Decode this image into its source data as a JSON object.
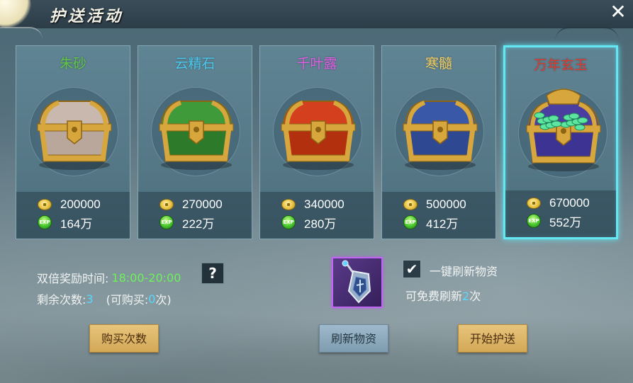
{
  "window": {
    "title": "护送活动"
  },
  "chests": [
    {
      "name": "朱砂",
      "name_color": "#62c64a",
      "gold": "200000",
      "exp": "164万",
      "lid": "#c9b8ad",
      "body": "#b9a79c",
      "selected": false,
      "icon": "silver-chest-icon"
    },
    {
      "name": "云精石",
      "name_color": "#4cc9f0",
      "gold": "270000",
      "exp": "222万",
      "lid": "#3f9a3a",
      "body": "#2d7b2a",
      "selected": false,
      "icon": "green-chest-icon"
    },
    {
      "name": "千叶露",
      "name_color": "#e45ce8",
      "gold": "340000",
      "exp": "280万",
      "lid": "#d4401e",
      "body": "#b3300f",
      "selected": false,
      "icon": "red-chest-icon"
    },
    {
      "name": "寒髓",
      "name_color": "#f3d066",
      "gold": "500000",
      "exp": "412万",
      "lid": "#3a58a8",
      "body": "#2f4892",
      "selected": false,
      "icon": "blue-chest-icon"
    },
    {
      "name": "万年玄玉",
      "name_color": "#e23a2f",
      "gold": "670000",
      "exp": "552万",
      "lid": "#4a3fa0",
      "body": "#3c3392",
      "selected": true,
      "icon": "jade-treasure-chest-icon"
    }
  ],
  "rewards": {
    "exp_badge": "EXP"
  },
  "info": {
    "double_label": "双倍奖励时间:",
    "double_time": "18:00-20:00",
    "help_label": "?",
    "remain_label": "剩余次数:",
    "remain_value": "3",
    "buyable_prefix": "(可购买:",
    "buyable_value": "0",
    "buyable_suffix": "次)"
  },
  "refresh": {
    "checkbox_mark": "✔",
    "one_key_label": "一键刷新物资",
    "free_prefix": "可免费刷新",
    "free_value": "2",
    "free_suffix": "次"
  },
  "buttons": {
    "buy": "购买次数",
    "refresh": "刷新物资",
    "start": "开始护送"
  },
  "colors": {
    "accent_cyan": "#63e7f2",
    "button_gold": "#e0bb70",
    "button_blue": "#90adbf"
  }
}
